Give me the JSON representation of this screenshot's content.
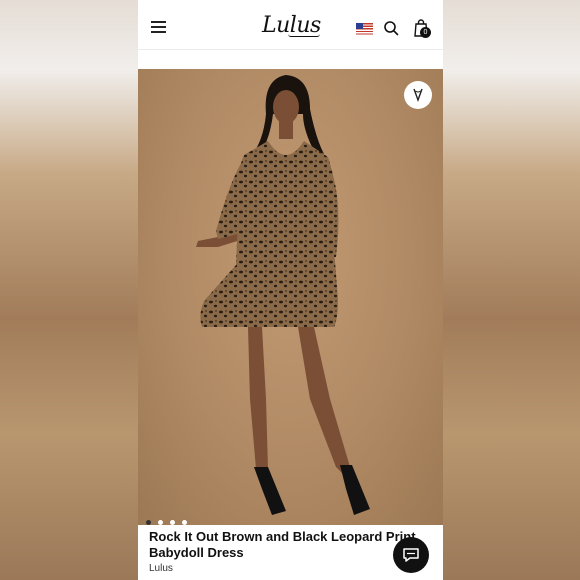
{
  "header": {
    "logo_text": "Lulus",
    "bag_count": "0",
    "icons": [
      "hamburger-menu-icon",
      "us-flag-icon",
      "search-icon",
      "shopping-bag-icon"
    ]
  },
  "promo": {
    "text": "",
    "link_label": ""
  },
  "gallery": {
    "total_images": 4,
    "active_index": 0,
    "wishlist_icon": "heart-icon"
  },
  "product": {
    "title": "Rock It Out Brown and Black Leopard Print Babydoll Dress",
    "brand": "Lulus"
  },
  "chat": {
    "icon": "chat-bubble-icon"
  },
  "colors": {
    "background": "#b08a64",
    "text": "#111111",
    "chat_button": "#111111"
  }
}
